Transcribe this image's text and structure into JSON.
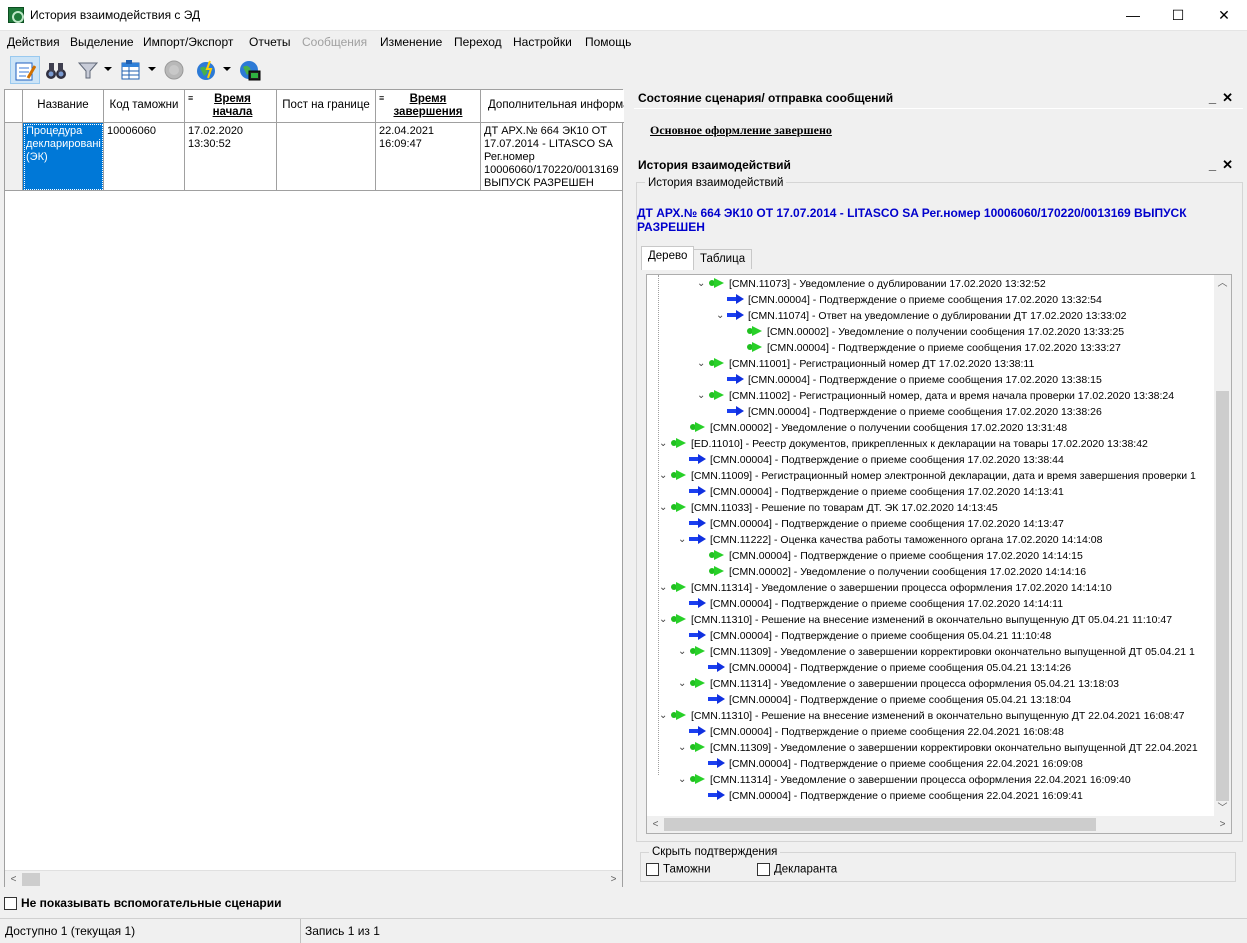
{
  "window": {
    "title": "История взаимодействия с ЭД",
    "minimize": "—",
    "maximize": "☐",
    "close": "✕"
  },
  "menu": [
    "Действия",
    "Выделение",
    "Импорт/Экспорт",
    "Отчеты",
    "Сообщения",
    "Изменение",
    "Переход",
    "Настройки",
    "Помощь"
  ],
  "menu_disabled": [
    "Сообщения"
  ],
  "toolbar": [
    {
      "icon": "edit-document-icon",
      "selected": true
    },
    {
      "icon": "binoculars-find-icon"
    },
    {
      "icon": "filter-icon",
      "dropdown": true
    },
    {
      "icon": "table-view-icon",
      "dropdown": true
    },
    {
      "icon": "disabled-circle-icon"
    },
    {
      "icon": "globe-lightning-icon",
      "dropdown": true
    },
    {
      "icon": "globe-monitor-icon"
    }
  ],
  "grid": {
    "columns": [
      "Название",
      "Код таможни",
      "Время начала",
      "Пост на границе",
      "Время завершения",
      "Дополнительная информа"
    ],
    "sort_mark": "≡",
    "row": {
      "name": "Процедура декларировані (ЭК)",
      "customs_code": "10006060",
      "start_time": "17.02.2020 13:30:52",
      "border_post": "",
      "end_time": "22.04.2021 16:09:47",
      "extra": "ДТ АРХ.№ 664 ЭК10 ОТ 17.07.2014 - LITASCO SA Рег.номер 10006060/170220/0013169 ВЫПУСК РАЗРЕШЕН"
    }
  },
  "hide_aux_label": "Не показывать вспомогательные сценарии",
  "status": {
    "available": "Доступно 1 (текущая 1)",
    "record": "Запись 1 из 1"
  },
  "state_panel": {
    "title": "Состояние сценария/ отправка сообщений",
    "link": "Основное оформление завершено"
  },
  "history_panel": {
    "title": "История взаимодействий",
    "group_label": "История взаимодействий",
    "doc": "ДТ АРХ.№ 664 ЭК10 ОТ 17.07.2014 - LITASCO SA Рег.номер 10006060/170220/0013169 ВЫПУСК РАЗРЕШЕН",
    "tabs": [
      "Дерево",
      "Таблица"
    ]
  },
  "tree": [
    {
      "level": 3,
      "icon": "green",
      "expand": true,
      "text": "[CMN.11073] - Уведомление о дублировании 17.02.2020 13:32:52"
    },
    {
      "level": 4,
      "icon": "blue",
      "text": "[CMN.00004] - Подтверждение о приеме сообщения 17.02.2020 13:32:54"
    },
    {
      "level": 4,
      "icon": "blue",
      "expand": true,
      "text": "[CMN.11074] - Ответ на уведомление о дублировании ДТ 17.02.2020 13:33:02"
    },
    {
      "level": 5,
      "icon": "green",
      "text": "[CMN.00002] - Уведомление о получении сообщения 17.02.2020 13:33:25"
    },
    {
      "level": 5,
      "icon": "green",
      "text": "[CMN.00004] - Подтверждение о приеме сообщения 17.02.2020 13:33:27"
    },
    {
      "level": 3,
      "icon": "green",
      "expand": true,
      "text": "[CMN.11001] - Регистрационный номер ДТ 17.02.2020 13:38:11"
    },
    {
      "level": 4,
      "icon": "blue",
      "text": "[CMN.00004] - Подтверждение о приеме сообщения 17.02.2020 13:38:15"
    },
    {
      "level": 3,
      "icon": "green",
      "expand": true,
      "text": "[CMN.11002] - Регистрационный номер, дата и время начала проверки 17.02.2020 13:38:24"
    },
    {
      "level": 4,
      "icon": "blue",
      "text": "[CMN.00004] - Подтверждение о приеме сообщения 17.02.2020 13:38:26"
    },
    {
      "level": 2,
      "icon": "green",
      "text": "[CMN.00002] - Уведомление о получении сообщения 17.02.2020 13:31:48"
    },
    {
      "level": 1,
      "icon": "green",
      "expand": true,
      "text": "[ED.11010] - Реестр документов, прикрепленных к декларации на товары 17.02.2020 13:38:42"
    },
    {
      "level": 2,
      "icon": "blue",
      "text": "[CMN.00004] - Подтверждение о приеме сообщения 17.02.2020 13:38:44"
    },
    {
      "level": 1,
      "icon": "green",
      "expand": true,
      "text": "[CMN.11009] - Регистрационный номер электронной декларации, дата и время завершения проверки 1"
    },
    {
      "level": 2,
      "icon": "blue",
      "text": "[CMN.00004] - Подтверждение о приеме сообщения 17.02.2020 14:13:41"
    },
    {
      "level": 1,
      "icon": "green",
      "expand": true,
      "text": "[CMN.11033] - Решение по товарам ДТ. ЭК 17.02.2020 14:13:45"
    },
    {
      "level": 2,
      "icon": "blue",
      "text": "[CMN.00004] - Подтверждение о приеме сообщения 17.02.2020 14:13:47"
    },
    {
      "level": 2,
      "icon": "blue",
      "expand": true,
      "text": "[CMN.11222] - Оценка качества работы таможенного органа 17.02.2020 14:14:08"
    },
    {
      "level": 3,
      "icon": "green",
      "text": "[CMN.00004] - Подтверждение о приеме сообщения 17.02.2020 14:14:15"
    },
    {
      "level": 3,
      "icon": "green",
      "text": "[CMN.00002] - Уведомление о получении сообщения 17.02.2020 14:14:16"
    },
    {
      "level": 1,
      "icon": "green",
      "expand": true,
      "text": "[CMN.11314] - Уведомление о завершении процесса оформления 17.02.2020 14:14:10"
    },
    {
      "level": 2,
      "icon": "blue",
      "text": "[CMN.00004] - Подтверждение о приеме сообщения 17.02.2020 14:14:11"
    },
    {
      "level": 1,
      "icon": "green",
      "expand": true,
      "text": "[CMN.11310] - Решение на внесение изменений в окончательно выпущенную ДТ 05.04.21 11:10:47"
    },
    {
      "level": 2,
      "icon": "blue",
      "text": "[CMN.00004] - Подтверждение о приеме сообщения 05.04.21 11:10:48"
    },
    {
      "level": 2,
      "icon": "green",
      "expand": true,
      "text": "[CMN.11309] - Уведомление о завершении корректировки окончательно выпущенной ДТ 05.04.21 1"
    },
    {
      "level": 3,
      "icon": "blue",
      "text": "[CMN.00004] - Подтверждение о приеме сообщения 05.04.21 13:14:26"
    },
    {
      "level": 2,
      "icon": "green",
      "expand": true,
      "text": "[CMN.11314] - Уведомление о завершении процесса оформления 05.04.21 13:18:03"
    },
    {
      "level": 3,
      "icon": "blue",
      "text": "[CMN.00004] - Подтверждение о приеме сообщения 05.04.21 13:18:04"
    },
    {
      "level": 1,
      "icon": "green",
      "expand": true,
      "text": "[CMN.11310] - Решение на внесение изменений в окончательно выпущенную ДТ 22.04.2021 16:08:47"
    },
    {
      "level": 2,
      "icon": "blue",
      "text": "[CMN.00004] - Подтверждение о приеме сообщения 22.04.2021 16:08:48"
    },
    {
      "level": 2,
      "icon": "green",
      "expand": true,
      "text": "[CMN.11309] - Уведомление о завершении корректировки окончательно выпущенной ДТ 22.04.2021"
    },
    {
      "level": 3,
      "icon": "blue",
      "text": "[CMN.00004] - Подтверждение о приеме сообщения 22.04.2021 16:09:08"
    },
    {
      "level": 2,
      "icon": "green",
      "expand": true,
      "text": "[CMN.11314] - Уведомление о завершении процесса оформления 22.04.2021 16:09:40"
    },
    {
      "level": 3,
      "icon": "blue",
      "text": "[CMN.00004] - Подтверждение о приеме сообщения 22.04.2021 16:09:41"
    }
  ],
  "filter": {
    "label": "Скрыть подтверждения",
    "options": [
      "Таможни",
      "Декларанта"
    ]
  },
  "colors": {
    "selection": "#0078d7",
    "doc_text": "#0000cc",
    "sent_arrow": "#1b3ff0",
    "recv_arrow": "#28d028"
  }
}
